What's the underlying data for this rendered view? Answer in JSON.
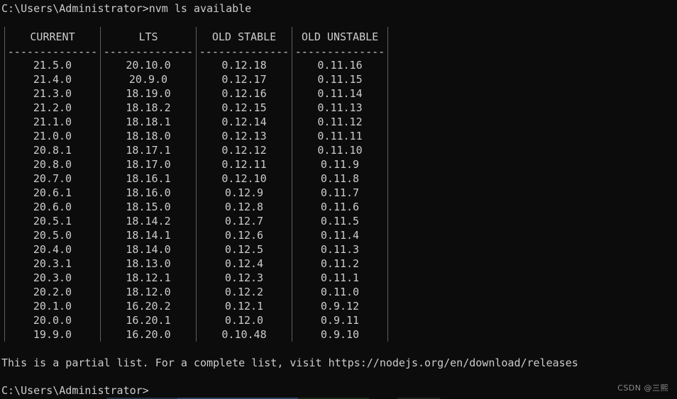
{
  "terminal": {
    "background_color": "#0c0c0c",
    "text_color": "#cccccc",
    "divider_color": "#5a5f66",
    "prompt_top": "C:\\Users\\Administrator>nvm ls available",
    "prompt_bottom": "C:\\Users\\Administrator>",
    "footer_note": "This is a partial list. For a complete list, visit https://nodejs.org/en/download/releases",
    "watermark": "CSDN @三熙"
  },
  "table": {
    "headers": [
      "CURRENT",
      "LTS",
      "OLD STABLE",
      "OLD UNSTABLE"
    ],
    "separator": "--------------",
    "rows": [
      [
        "21.5.0",
        "20.10.0",
        "0.12.18",
        "0.11.16"
      ],
      [
        "21.4.0",
        "20.9.0",
        "0.12.17",
        "0.11.15"
      ],
      [
        "21.3.0",
        "18.19.0",
        "0.12.16",
        "0.11.14"
      ],
      [
        "21.2.0",
        "18.18.2",
        "0.12.15",
        "0.11.13"
      ],
      [
        "21.1.0",
        "18.18.1",
        "0.12.14",
        "0.11.12"
      ],
      [
        "21.0.0",
        "18.18.0",
        "0.12.13",
        "0.11.11"
      ],
      [
        "20.8.1",
        "18.17.1",
        "0.12.12",
        "0.11.10"
      ],
      [
        "20.8.0",
        "18.17.0",
        "0.12.11",
        "0.11.9"
      ],
      [
        "20.7.0",
        "18.16.1",
        "0.12.10",
        "0.11.8"
      ],
      [
        "20.6.1",
        "18.16.0",
        "0.12.9",
        "0.11.7"
      ],
      [
        "20.6.0",
        "18.15.0",
        "0.12.8",
        "0.11.6"
      ],
      [
        "20.5.1",
        "18.14.2",
        "0.12.7",
        "0.11.5"
      ],
      [
        "20.5.0",
        "18.14.1",
        "0.12.6",
        "0.11.4"
      ],
      [
        "20.4.0",
        "18.14.0",
        "0.12.5",
        "0.11.3"
      ],
      [
        "20.3.1",
        "18.13.0",
        "0.12.4",
        "0.11.2"
      ],
      [
        "20.3.0",
        "18.12.1",
        "0.12.3",
        "0.11.1"
      ],
      [
        "20.2.0",
        "18.12.0",
        "0.12.2",
        "0.11.0"
      ],
      [
        "20.1.0",
        "16.20.2",
        "0.12.1",
        "0.9.12"
      ],
      [
        "20.0.0",
        "16.20.1",
        "0.12.0",
        "0.9.11"
      ],
      [
        "19.9.0",
        "16.20.0",
        "0.10.48",
        "0.9.10"
      ]
    ]
  }
}
